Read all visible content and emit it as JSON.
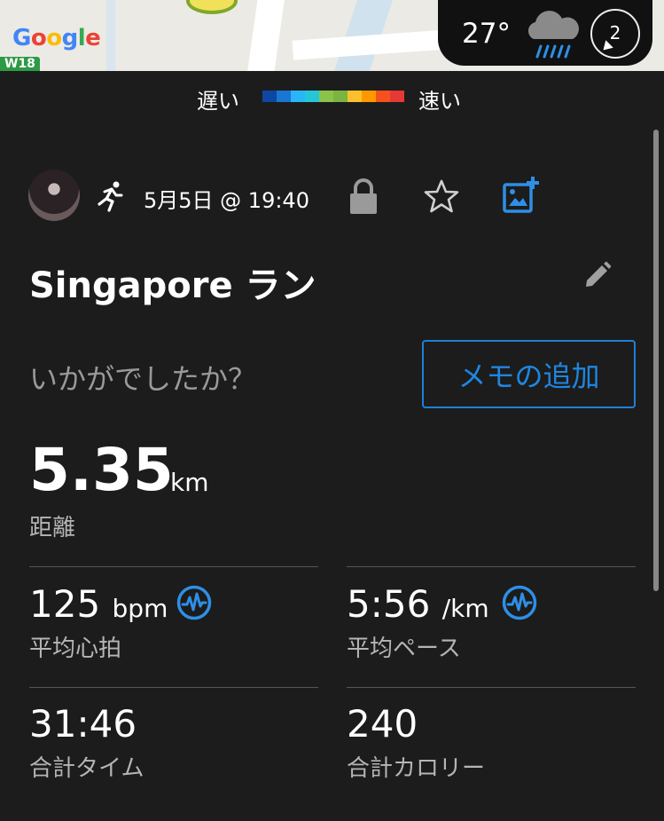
{
  "map": {
    "logo_text": "Google",
    "road_badge": "W18",
    "weather": {
      "temperature": "27°",
      "icon": "rain-cloud-icon",
      "compass_value": "2"
    }
  },
  "legend": {
    "slow_label": "遅い",
    "fast_label": "速い",
    "colors": [
      "#0d47a1",
      "#1976d2",
      "#29b6f6",
      "#26c6da",
      "#8bc34a",
      "#7cb342",
      "#fbc02d",
      "#ff9800",
      "#f4511e",
      "#e53935"
    ]
  },
  "activity": {
    "type_icon": "running-icon",
    "date_time": "5月5日 @ 19:40",
    "title": "Singapore ラン",
    "feel_prompt": "いかがでしたか？",
    "memo_button": "メモの追加"
  },
  "distance": {
    "value": "5.35",
    "unit": "km",
    "label": "距離"
  },
  "stats": {
    "heart_rate": {
      "value": "125",
      "unit": "bpm",
      "label": "平均心拍"
    },
    "pace": {
      "value": "5:56",
      "unit": "/km",
      "label": "平均ペース"
    },
    "time": {
      "value": "31:46",
      "label": "合計タイム"
    },
    "calories": {
      "value": "240",
      "label": "合計カロリー"
    }
  },
  "colors": {
    "accent": "#1f86e0",
    "background": "#1c1c1c",
    "secondary_text": "#b5b5b5"
  }
}
